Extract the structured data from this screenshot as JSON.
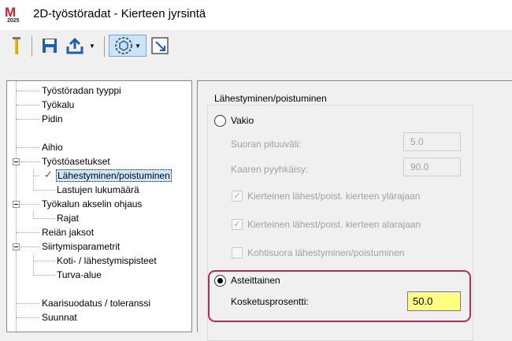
{
  "window": {
    "logo": {
      "mark": "M",
      "year": "2025"
    },
    "title": "2D-työstöradat - Kierteen jyrsintä"
  },
  "toolbar": {
    "icons": [
      "tool-icon",
      "save-icon",
      "export-icon",
      "view-mode-icon",
      "window-icon"
    ]
  },
  "tree": {
    "items": [
      {
        "label": "Työstöradan tyyppi"
      },
      {
        "label": "Työkalu"
      },
      {
        "label": "Pidin"
      },
      {
        "label": "Aihio"
      },
      {
        "label": "Työstöasetukset"
      },
      {
        "label": "Lähestyminen/poistuminen"
      },
      {
        "label": "Lastujen lukumäärä"
      },
      {
        "label": "Työkalun akselin ohjaus"
      },
      {
        "label": "Rajat"
      },
      {
        "label": "Reiän jaksot"
      },
      {
        "label": "Siirtymisparametrit"
      },
      {
        "label": "Koti- / lähestymispisteet"
      },
      {
        "label": "Turva-alue"
      },
      {
        "label": "Kaarisuodatus / toleranssi"
      },
      {
        "label": "Suunnat"
      }
    ]
  },
  "panel": {
    "group_title": "Lähestyminen/poistuminen",
    "vakio": {
      "label": "Vakio",
      "straight_label": "Suoran pituuväli:",
      "straight_value": "5.0",
      "arc_label": "Kaaren pyyhkäisy:",
      "arc_value": "90.0",
      "check_top": "Kierteinen lähest/poist. kierteen ylärajaan",
      "check_bottom": "Kierteinen lähest/poist. kierteen alarajaan",
      "check_direct": "Kohtisuora lähestyminen/poistuminen"
    },
    "stepwise": {
      "label": "Asteittainen",
      "contact_label": "Kosketusprosentti:",
      "contact_value": "50.0"
    }
  },
  "colors": {
    "highlight_border": "#b0304c",
    "highlight_field": "#ffff80",
    "selection": "#cce8ff"
  }
}
